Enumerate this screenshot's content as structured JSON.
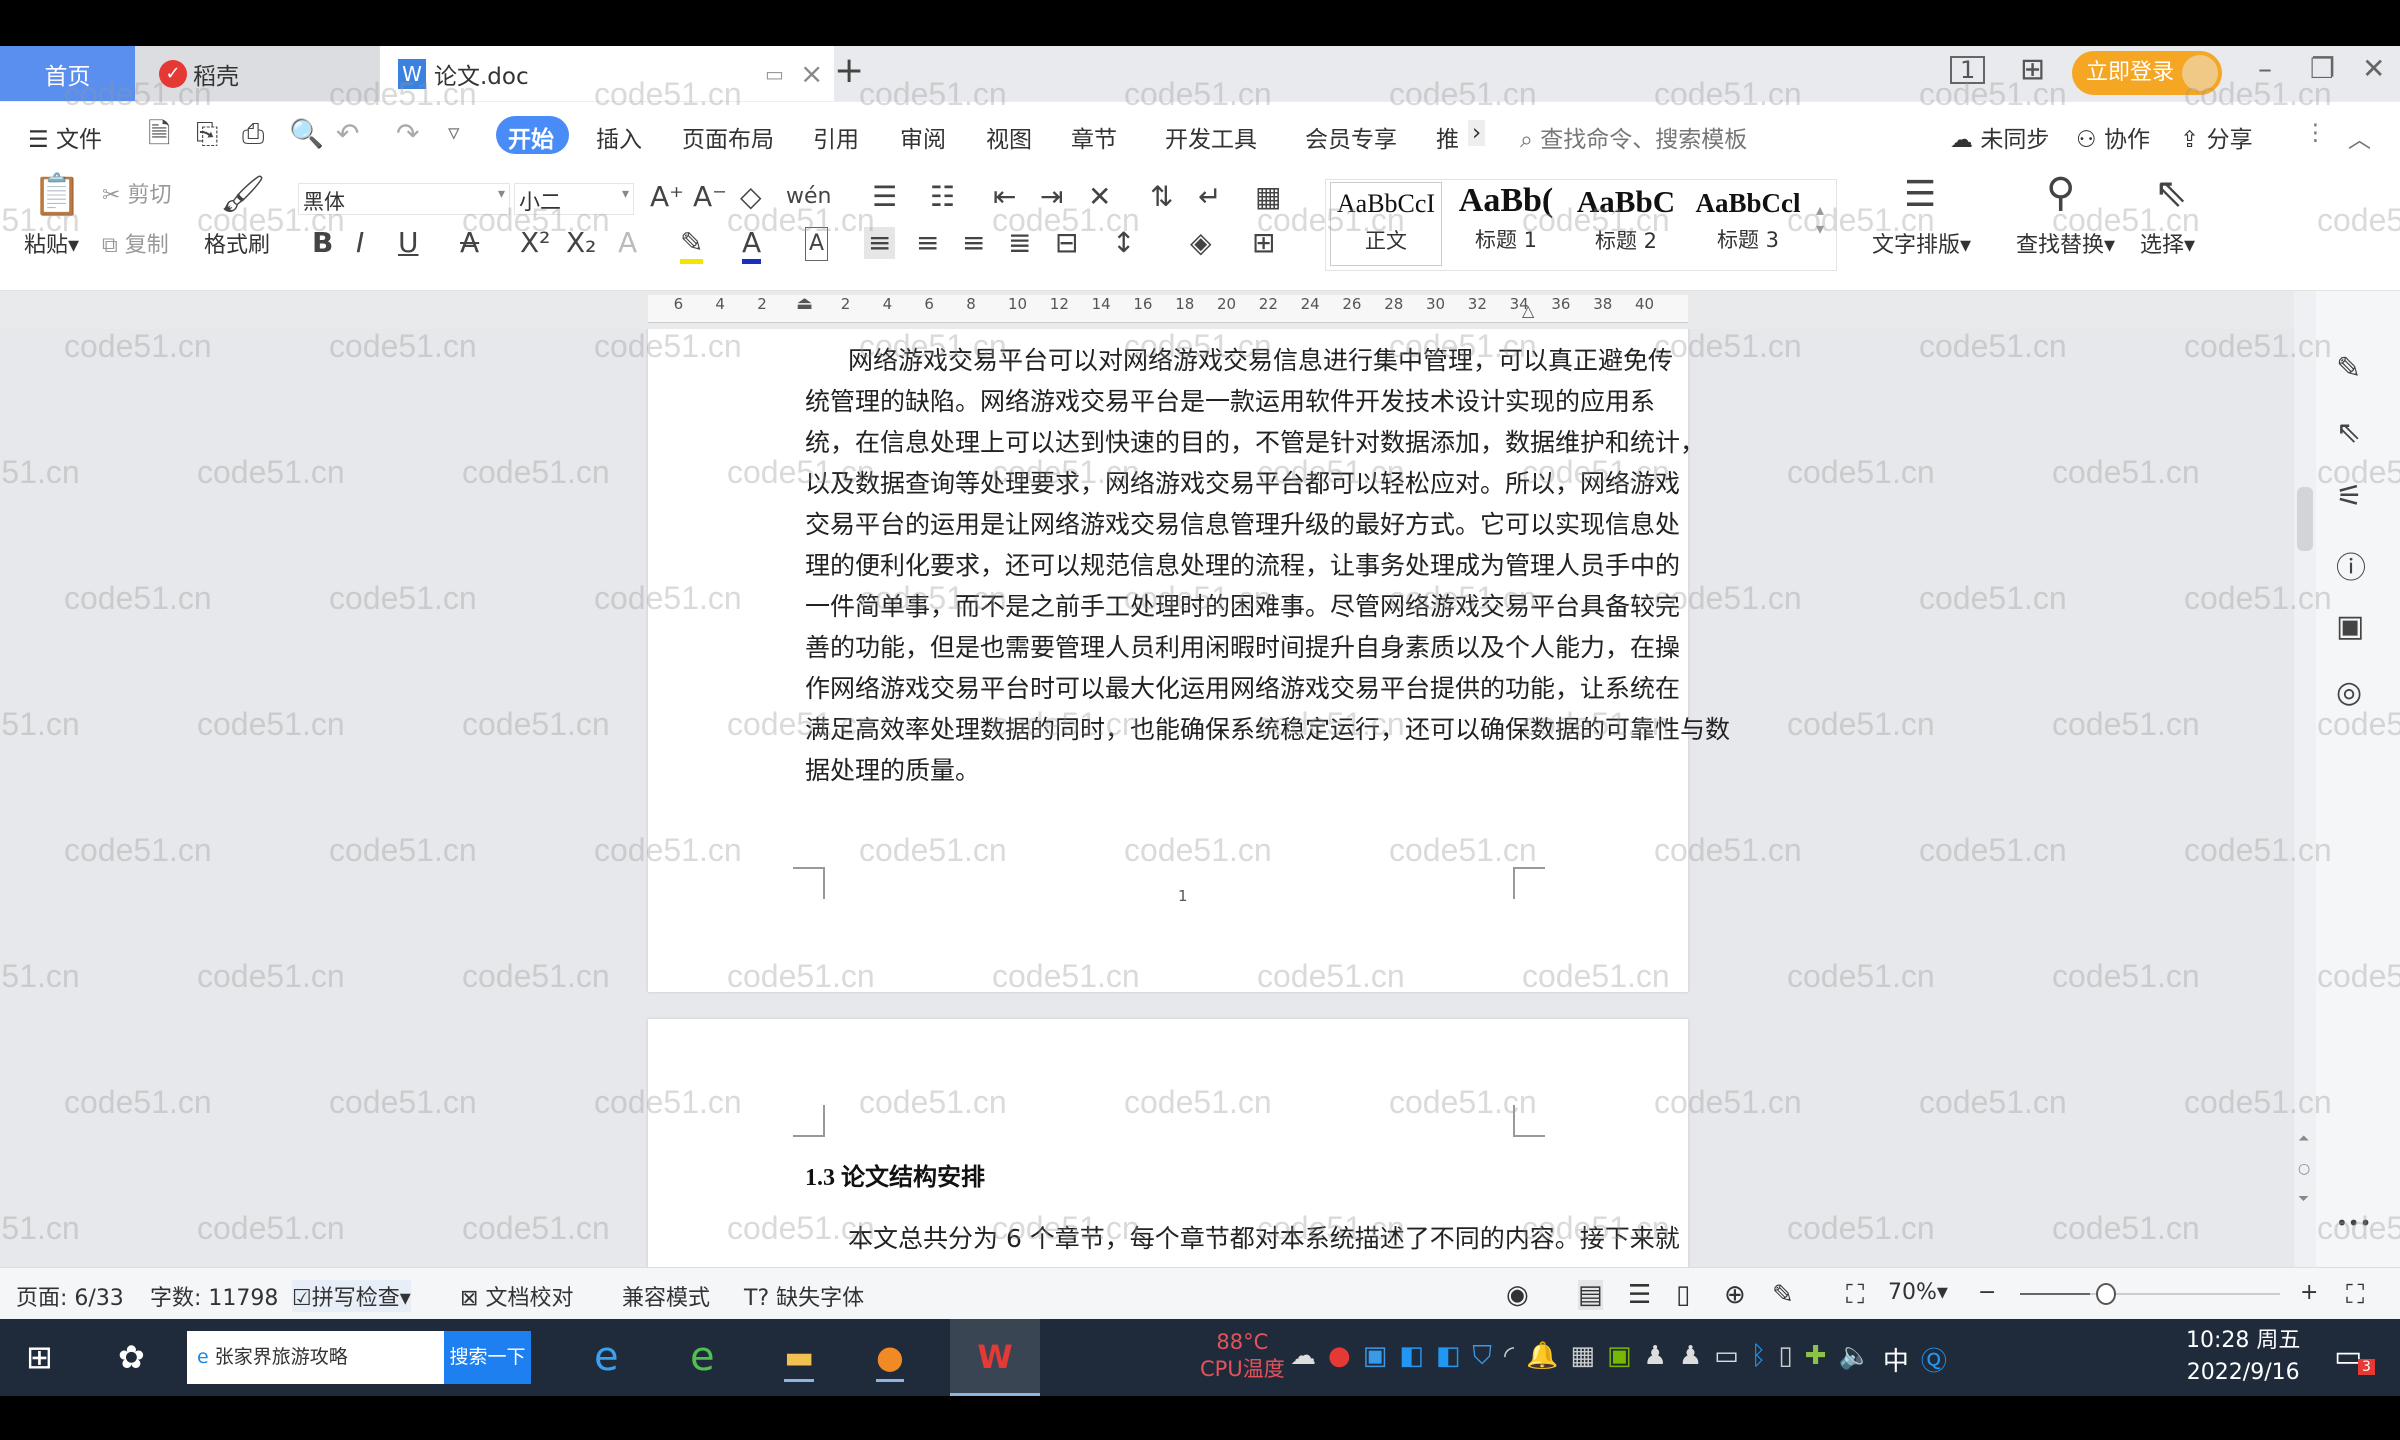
{
  "tabs": {
    "home": "首页",
    "daoke": "稻壳",
    "doc": "论文.doc",
    "new_tab": "+",
    "close": "×"
  },
  "account": {
    "login": "立即登录"
  },
  "window": {
    "minimize": "–",
    "restore": "❐",
    "close": "✕"
  },
  "menu": {
    "file": "文件",
    "items": [
      "开始",
      "插入",
      "页面布局",
      "引用",
      "审阅",
      "视图",
      "章节",
      "开发工具",
      "会员专享",
      "推"
    ],
    "more": "›",
    "search_placeholder": "查找命令、搜索模板",
    "sync": "未同步",
    "collab": "协作",
    "share": "分享"
  },
  "toolbar": {
    "paste": "粘贴",
    "cut": "剪切",
    "copy": "复制",
    "format_painter": "格式刷",
    "font_name": "黑体",
    "font_size": "小二",
    "styles": [
      {
        "sample": "AaBbCcI",
        "label": "正文"
      },
      {
        "sample": "AaBb(",
        "label": "标题 1"
      },
      {
        "sample": "AaBbC",
        "label": "标题 2"
      },
      {
        "sample": "AaBbCcl",
        "label": "标题 3"
      }
    ],
    "text_layout": "文字排版",
    "find_replace": "查找替换",
    "select": "选择"
  },
  "ruler": {
    "labels": [
      "6",
      "4",
      "2",
      "2",
      "4",
      "6",
      "8",
      "10",
      "12",
      "14",
      "16",
      "18",
      "20",
      "22",
      "24",
      "26",
      "28",
      "30",
      "32",
      "34",
      "36",
      "38",
      "40"
    ],
    "values": [
      -6,
      -4,
      -2,
      2,
      4,
      6,
      8,
      10,
      12,
      14,
      16,
      18,
      20,
      22,
      24,
      26,
      28,
      30,
      32,
      34,
      36,
      38,
      40
    ]
  },
  "document": {
    "page1_lines": [
      "网络游戏交易平台可以对网络游戏交易信息进行集中管理，可以真正避免传",
      "统管理的缺陷。网络游戏交易平台是一款运用软件开发技术设计实现的应用系",
      "统，在信息处理上可以达到快速的目的，不管是针对数据添加，数据维护和统计，",
      "以及数据查询等处理要求，网络游戏交易平台都可以轻松应对。所以，网络游戏",
      "交易平台的运用是让网络游戏交易信息管理升级的最好方式。它可以实现信息处",
      "理的便利化要求，还可以规范信息处理的流程，让事务处理成为管理人员手中的",
      "一件简单事，而不是之前手工处理时的困难事。尽管网络游戏交易平台具备较完",
      "善的功能，但是也需要管理人员利用闲暇时间提升自身素质以及个人能力，在操",
      "作网络游戏交易平台时可以最大化运用网络游戏交易平台提供的功能，让系统在",
      "满足高效率处理数据的同时，也能确保系统稳定运行，还可以确保数据的可靠性与数",
      "据处理的质量。"
    ],
    "page_number": "1",
    "heading": "1.3 论文结构安排",
    "page2_line": "本文总共分为 6 个章节，每个章节都对本系统描述了不同的内容。接下来就"
  },
  "status": {
    "page": "页面: 6/33",
    "words": "字数: 11798",
    "spell": "拼写检查",
    "proof": "文档校对",
    "compat": "兼容模式",
    "missing_font": "缺失字体",
    "zoom": "70%"
  },
  "taskbar": {
    "search_text": "张家界旅游攻略",
    "search_button": "搜索一下",
    "cpu_temp": "88°C",
    "cpu_label": "CPU温度",
    "ime": "中",
    "time": "10:28 周五",
    "date": "2022/9/16",
    "notif_count": "3"
  },
  "watermark": "code51.cn",
  "colors": {
    "accent": "#4a8cf7",
    "login": "#f5a623",
    "wps_red": "#e53935",
    "taskbar": "#1f2b3a"
  }
}
